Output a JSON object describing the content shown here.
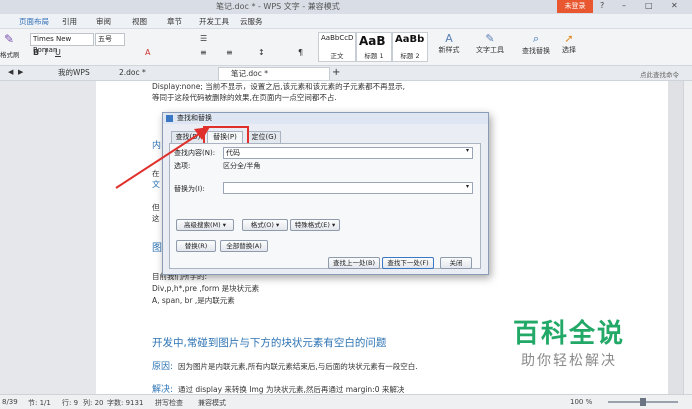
{
  "window": {
    "title": "笔记.doc * - WPS 文字 - 兼容模式",
    "user_button": "未登录",
    "controls": [
      "?",
      "–",
      "□",
      "✕"
    ]
  },
  "menu": [
    "页面布局",
    "引用",
    "审阅",
    "视图",
    "章节",
    "开发工具",
    "云服务"
  ],
  "ribbon": {
    "font_name": "Times New Roman",
    "font_size": "五号",
    "format_painter": "格式刷",
    "styles": [
      {
        "preview": "AaBbCcD",
        "label": "正文"
      },
      {
        "preview": "AaB",
        "label": "标题 1"
      },
      {
        "preview": "AaBb",
        "label": "标题 2"
      }
    ],
    "new_style": "新样式",
    "text_tools": "文字工具",
    "find_replace": "查找替换",
    "select": "选择"
  },
  "tabs": [
    {
      "label": "我的WPS"
    },
    {
      "label": "2.doc *"
    },
    {
      "label": "笔记.doc *"
    }
  ],
  "tabs_add": "+",
  "right_pane_label": "点此查找命令",
  "page": {
    "line1": "Display:none; 当前不显示，设置之后,该元素和该元素的子元素都不再显示,",
    "line2": "等同于这段代码被删除的效果,在页面内一点空间都不占.",
    "frag_heading": "内",
    "frag_a": "在",
    "frag_b": "文",
    "frag_c": "但",
    "frag_d": "这",
    "frag_heading2": "图",
    "block_line1": "目前我们所学的:",
    "block_line2": "Div,p,h*,pre ,form 是块状元素",
    "block_line3": "A, span, br ,是内联元素",
    "heading": "开发中,常碰到图片与下方的块状元素有空白的问题",
    "reason_label": "原因:",
    "reason_text": "因为图片是内联元素,所有内联元素结束后,与后面的块状元素有一段空白.",
    "solution_label": "解决:",
    "solution_text": "通过 display 来转换 Img 为块状元素,然后再通过 margin:0 来解决"
  },
  "dialog": {
    "title": "查找和替换",
    "tabs": [
      "查找(D)",
      "替换(P)",
      "定位(G)"
    ],
    "find_label": "查找内容(N):",
    "find_value": "代码",
    "options_label": "选项:",
    "options_value": "区分全/半角",
    "replace_label": "替换为(I):",
    "replace_value": "",
    "advanced": "高级搜索(M) ▾",
    "format": "格式(O) ▾",
    "special": "特殊格式(E) ▾",
    "replace_btn": "替换(R)",
    "replace_all_btn": "全部替换(A)",
    "find_prev_btn": "查找上一处(B)",
    "find_next_btn": "查找下一处(F)",
    "close_btn": "关闭"
  },
  "status": {
    "page": "8/39",
    "section": "节: 1/1",
    "row": "行: 9",
    "col": "列: 20",
    "words": "字数: 9131",
    "spell": "拼写检查",
    "compat": "兼容模式",
    "zoom": "100 %"
  },
  "watermark": {
    "title": "百科全说",
    "subtitle": "助你轻松解决"
  },
  "colors": {
    "accent": "#2e74b5",
    "highlight_red": "#e0302b",
    "watermark_green": "#22a867",
    "user_button": "#e8572f"
  }
}
